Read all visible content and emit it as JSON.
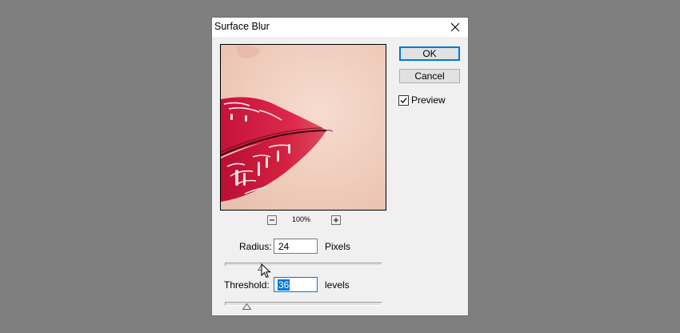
{
  "dialog": {
    "title": "Surface Blur"
  },
  "buttons": {
    "ok_label": "OK",
    "cancel_label": "Cancel"
  },
  "preview": {
    "label": "Preview",
    "checked": true
  },
  "zoom": {
    "value": "100%"
  },
  "radius": {
    "label": "Radius:",
    "value": "24",
    "unit": "Pixels",
    "slider_fraction": 0.24
  },
  "threshold": {
    "label": "Threshold:",
    "value": "36",
    "unit": "levels",
    "slider_fraction": 0.14
  },
  "colors": {
    "accent": "#0078d7",
    "lip_red": "#d91e3f",
    "skin": "#f0d1c3"
  }
}
